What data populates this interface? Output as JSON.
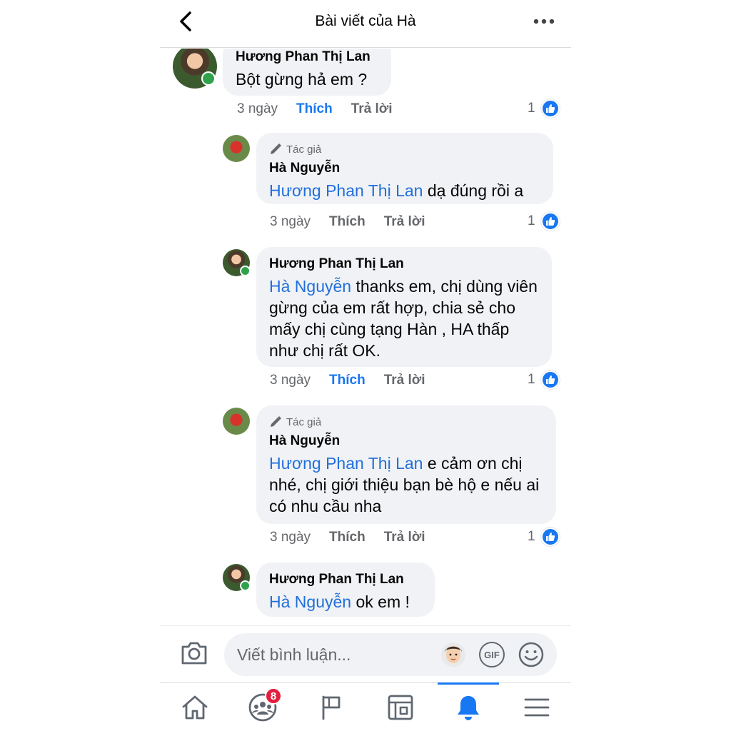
{
  "header": {
    "title": "Bài viết của Hà"
  },
  "comments": [
    {
      "author": "Hương Phan Thị Lan",
      "author_tag": "",
      "mention": "",
      "text": "Bột gừng hả em ?",
      "time": "3 ngày",
      "like_label": "Thích",
      "reply_label": "Trả lời",
      "reactions": "1",
      "liked": true
    },
    {
      "author": "Hà Nguyễn",
      "author_tag": "Tác giả",
      "mention": "Hương Phan Thị Lan",
      "text": " dạ đúng rồi a",
      "time": "3 ngày",
      "like_label": "Thích",
      "reply_label": "Trả lời",
      "reactions": "1",
      "liked": false
    },
    {
      "author": "Hương Phan Thị Lan",
      "author_tag": "",
      "mention": "Hà Nguyễn",
      "text": " thanks em, chị dùng viên gừng của em rất hợp, chia sẻ cho mấy chị cùng tạng Hàn , HA thấp như chị rất OK.",
      "time": "3 ngày",
      "like_label": "Thích",
      "reply_label": "Trả lời",
      "reactions": "1",
      "liked": true
    },
    {
      "author": "Hà Nguyễn",
      "author_tag": "Tác giả",
      "mention": "Hương Phan Thị Lan",
      "text": "  e cảm ơn chị nhé, chị giới thiệu bạn bè hộ e nếu ai có nhu cầu nha",
      "time": "3 ngày",
      "like_label": "Thích",
      "reply_label": "Trả lời",
      "reactions": "1",
      "liked": false
    },
    {
      "author": "Hương Phan Thị Lan",
      "author_tag": "",
      "mention": "Hà Nguyễn",
      "text": " ok em !",
      "time": "",
      "like_label": "",
      "reply_label": "",
      "reactions": "",
      "liked": false
    }
  ],
  "composer": {
    "placeholder": "Viết bình luận...",
    "gif_label": "GIF"
  },
  "tabbar": {
    "tabs": [
      {
        "icon": "home-icon"
      },
      {
        "icon": "groups-icon",
        "badge": "8"
      },
      {
        "icon": "pages-flag-icon"
      },
      {
        "icon": "news-feed-icon"
      },
      {
        "icon": "notifications-bell-icon",
        "active": true
      },
      {
        "icon": "menu-icon"
      }
    ]
  },
  "colors": {
    "accent": "#1877f2",
    "mention": "#216fdb",
    "bubble": "#f0f2f5",
    "online": "#31a24c",
    "badge": "#e41e3f"
  }
}
